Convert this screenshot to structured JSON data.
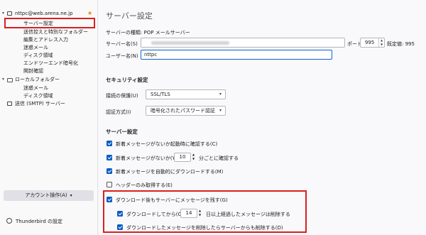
{
  "sidebar": {
    "account": "nttpc@web.arena.ne.jp",
    "items": [
      "サーバー設定",
      "送信控えと特別なフォルダー",
      "編集とアドレス入力",
      "迷惑メール",
      "ディスク領域",
      "エンドツーエンド暗号化",
      "開封確認"
    ],
    "local_folders": "ローカルフォルダー",
    "local_items": [
      "迷惑メール",
      "ディスク領域"
    ],
    "smtp": "送信 (SMTP) サーバー",
    "account_actions": "アカウント操作(A)",
    "tb_settings": "Thunderbird の設定"
  },
  "main": {
    "title": "サーバー設定",
    "server_type": "サーバーの種類: POP メールサーバー",
    "server_name_label": "サーバー名(S)",
    "port_label": "ポート(P)",
    "port_value": "995",
    "default_port": "既定値: 995",
    "username_label": "ユーザー名(N)",
    "username_value": "nttpc",
    "security_heading": "セキュリティ設定",
    "conn_security_label": "接続の保護(U)",
    "conn_security_value": "SSL/TLS",
    "auth_label": "認証方式(I)",
    "auth_value": "暗号化されたパスワード認証",
    "server_heading": "サーバー設定",
    "opt_check_startup": "新着メッセージがないか起動時に確認する(C)",
    "opt_check_every_pre": "新着メッセージがないか(Y)",
    "opt_check_every_value": "10",
    "opt_check_every_post": "分ごとに確認する",
    "opt_auto_download": "新着メッセージを自動的にダウンロードする(M)",
    "opt_headers_only": "ヘッダーのみ取得する(E)",
    "opt_leave_on_server": "ダウンロード後もサーバーにメッセージを残す(G)",
    "opt_delete_after_pre": "ダウンロードしてから(O)",
    "opt_delete_after_value": "14",
    "opt_delete_after_post": "日以上経過したメッセージは削除する",
    "opt_delete_sync": "ダウンロードしたメッセージを削除したらサーバーからも削除する(D)"
  }
}
